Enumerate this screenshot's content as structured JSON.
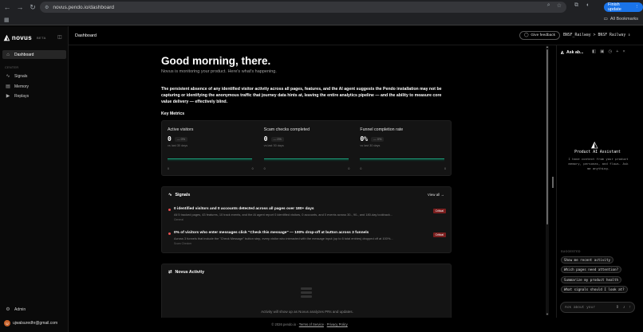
{
  "browser": {
    "url": "novus.pendo.io/dashboard",
    "finish_update": "Finish update",
    "all_bookmarks": "All Bookmarks"
  },
  "sidebar": {
    "brand": "novus",
    "beta": "BETA",
    "dashboard": "Dashboard",
    "section": "CENTER",
    "items": [
      "Signals",
      "Memory",
      "Replays"
    ],
    "admin": "Admin",
    "user_email": "ujwalsuredhr@gmail.com",
    "user_initial": "U"
  },
  "header": {
    "title": "Dashboard",
    "feedback": "Give feedback",
    "workspace": "BNSF_Railway",
    "workspace_sep": ">",
    "workspace2": "BNSF Railway"
  },
  "main": {
    "greeting": "Good morning, there.",
    "subtitle": "Novus is monitoring your product. Here's what's happening.",
    "insight": "The persistent absence of any identified visitor activity across all pages, features, and the AI agent suggests the Pendo installation may not be capturing or identifying the anonymous traffic that journey data hints at, leaving the entire analytics pipeline — and the ability to measure core value delivery — effectively blind.",
    "key_metrics": "Key Metrics",
    "metrics": [
      {
        "label": "Active visitors",
        "value": "0",
        "delta": "— 0%",
        "period": "vs last 30 days",
        "min": "0",
        "max": "0"
      },
      {
        "label": "Scam checks completed",
        "value": "0",
        "delta": "— 0%",
        "period": "vs last 30 days",
        "min": "0",
        "max": "0"
      },
      {
        "label": "Funnel completion rate",
        "value": "0%",
        "delta": "— 0%",
        "period": "vs last 30 days",
        "min": "0",
        "max": "0"
      }
    ],
    "signals": {
      "title": "Signals",
      "view_all": "View all →",
      "items": [
        {
          "title": "0 identified visitors and 0 accounts detected across all pages over 180+ days",
          "desc": "All 5 tracked pages, 43 features, 10 track events, and the AI agent report 0 identified visitors, 0 accounts, and 0 events across 30-, 90-, and 180-day lookback...",
          "source": "General",
          "badge": "Critical"
        },
        {
          "title": "0% of visitors who enter messages click \"Check this message\" — 100% drop-off at button across 3 funnels",
          "desc": "Across 3 funnels that include the \"Check Message\" button step, every visitor who interacted with the message input (up to 6 total entries) dropped off at 100%...",
          "source": "Scam Checker",
          "badge": "Critical"
        }
      ]
    },
    "activity": {
      "title": "Novus Activity",
      "empty": "Activity will show up as Novus analyzes PRs and updates."
    }
  },
  "footer": {
    "copyright": "© 2026 pendo.io",
    "terms": "Terms of Service",
    "sep": "·",
    "privacy": "Privacy Policy"
  },
  "ai_panel": {
    "title": "Ask ab...",
    "assistant_title": "Product AI Assistant",
    "assistant_desc": "I have context from your product memory, personas, and flows. Ask me anything.",
    "suggested_label": "SUGGESTED",
    "suggestions": [
      "Show me recent activity",
      "Which pages need attention?",
      "Summarize my product health",
      "What signals should I look at?"
    ],
    "input_placeholder": "Ask about your"
  },
  "colors": {
    "accent_green": "#1ca07a",
    "critical_red": "#e85050",
    "update_blue": "#1a73e8"
  }
}
